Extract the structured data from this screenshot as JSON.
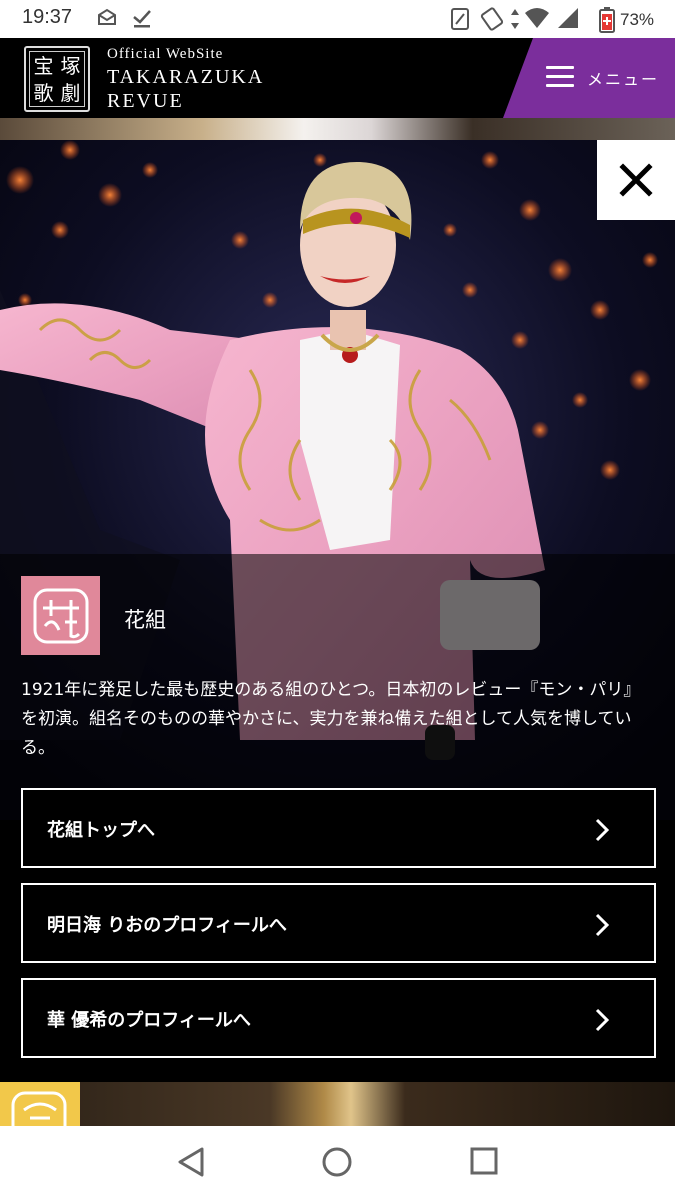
{
  "status_bar": {
    "time": "19:37",
    "battery_percent": "73%",
    "icons": [
      "email-icon",
      "download-done-icon",
      "nfc-icon",
      "rotate-icon",
      "data-arrows-icon",
      "wifi-icon",
      "signal-icon",
      "battery-icon"
    ]
  },
  "header": {
    "logo_chars": [
      "宝",
      "塚",
      "歌",
      "劇"
    ],
    "brand_small": "Official WebSite",
    "brand_line1": "TAKARAZUKA",
    "brand_line2": "REVUE",
    "menu_label": "メニュー",
    "menu_color": "#7b2e9c"
  },
  "modal": {
    "troupe_name": "花組",
    "emblem_color": "#e0889a",
    "description": "1921年に発足した最も歴史のある組のひとつ。日本初のレビュー『モン・パリ』を初演。組名そのものの華やかさに、実力を兼ね備えた組として人気を博している。",
    "links": [
      {
        "label": "花組トップへ"
      },
      {
        "label": "明日海 りおのプロフィールへ"
      },
      {
        "label": "華 優希のプロフィールへ"
      }
    ]
  },
  "nav": {
    "buttons": [
      "back-icon",
      "home-icon",
      "recents-icon"
    ]
  }
}
